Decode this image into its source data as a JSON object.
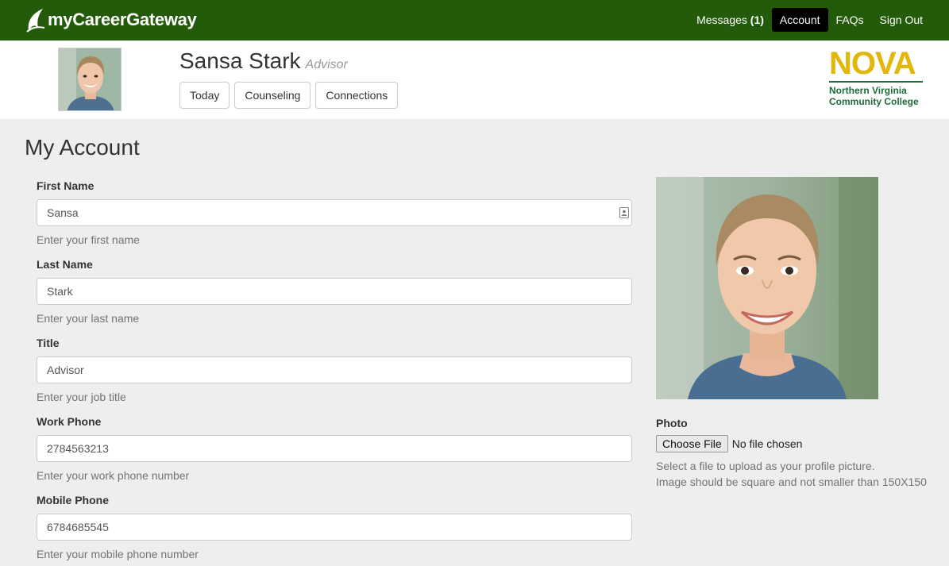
{
  "nav": {
    "brand": "myCareerGateway",
    "messages_label": "Messages",
    "messages_count": "(1)",
    "account": "Account",
    "faqs": "FAQs",
    "signout": "Sign Out"
  },
  "header": {
    "name": "Sansa Stark",
    "role": "Advisor",
    "tabs": [
      "Today",
      "Counseling",
      "Connections"
    ],
    "logo": {
      "main": "NOVA",
      "line1": "Northern Virginia",
      "line2": "Community College"
    }
  },
  "page": {
    "title": "My Account"
  },
  "form": {
    "first_name": {
      "label": "First Name",
      "value": "Sansa",
      "help": "Enter your first name"
    },
    "last_name": {
      "label": "Last Name",
      "value": "Stark",
      "help": "Enter your last name"
    },
    "title": {
      "label": "Title",
      "value": "Advisor",
      "help": "Enter your job title"
    },
    "work_phone": {
      "label": "Work Phone",
      "value": "2784563213",
      "help": "Enter your work phone number"
    },
    "mobile_phone": {
      "label": "Mobile Phone",
      "value": "6784685545",
      "help": "Enter your mobile phone number"
    }
  },
  "photo": {
    "label": "Photo",
    "choose_button": "Choose File",
    "file_status": "No file chosen",
    "help_line1": "Select a file to upload as your profile picture.",
    "help_line2": "Image should be square and not smaller than 150X150"
  },
  "colors": {
    "nav_bg": "#245b0a",
    "logo_gold": "#e2b70a",
    "logo_green": "#1f6b3a"
  }
}
